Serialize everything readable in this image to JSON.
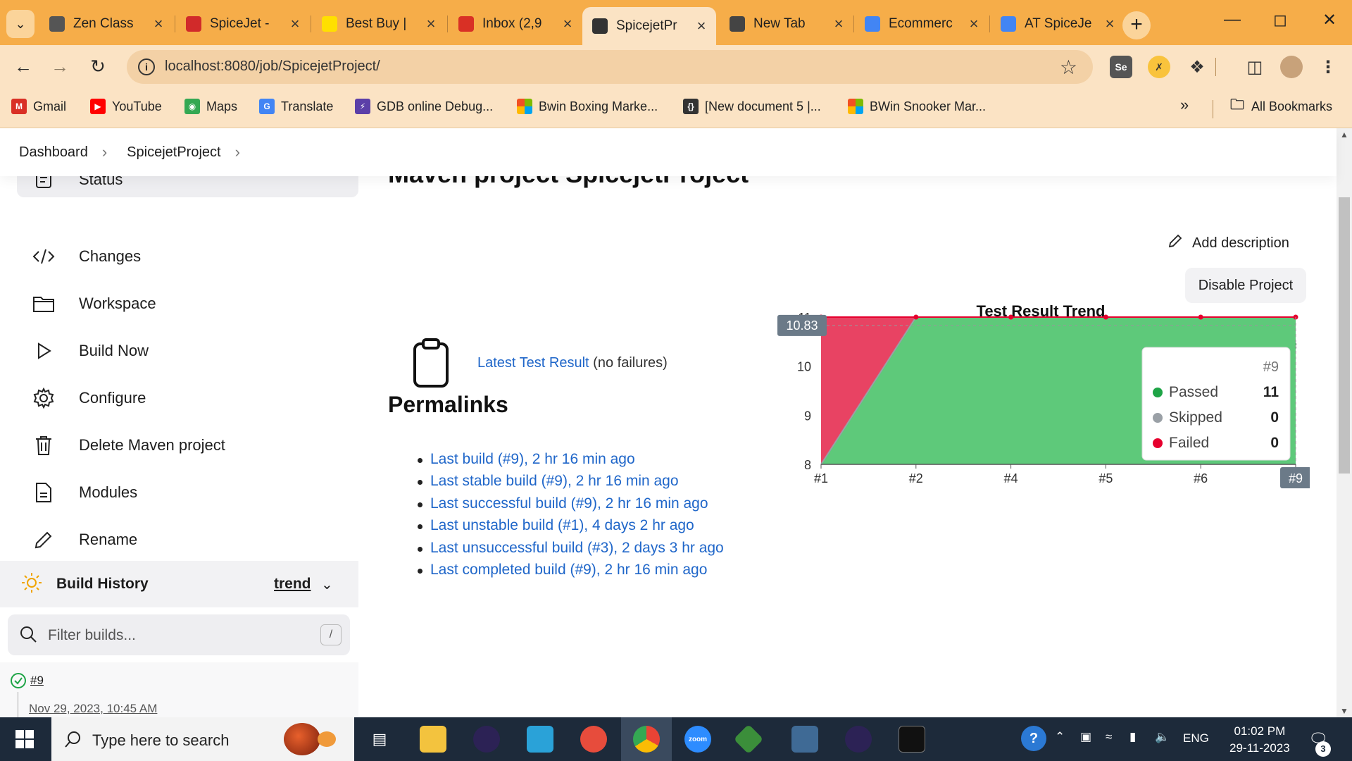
{
  "browser": {
    "tabs": [
      {
        "title": "Zen Class",
        "favicon": "zen-class-icon",
        "color": "#555555"
      },
      {
        "title": "SpiceJet -",
        "favicon": "spicejet-icon",
        "color": "#d12a2a"
      },
      {
        "title": "Best Buy |",
        "favicon": "bestbuy-tag-icon",
        "color": "#ffe000"
      },
      {
        "title": "Inbox (2,9",
        "favicon": "gmail-icon",
        "color": "#d93025"
      },
      {
        "title": "SpicejetPr",
        "favicon": "jenkins-icon",
        "color": "#333333"
      },
      {
        "title": "New Tab",
        "favicon": "chrome-icon",
        "color": "#444444"
      },
      {
        "title": "Ecommerc",
        "favicon": "docs-icon",
        "color": "#4285f4"
      },
      {
        "title": "AT SpiceJe",
        "favicon": "docs-icon",
        "color": "#4285f4"
      }
    ],
    "active_tab_index": 4,
    "url": "localhost:8080/job/SpicejetProject/",
    "bookmarks": [
      {
        "label": "Gmail",
        "icon": "gmail-icon"
      },
      {
        "label": "YouTube",
        "icon": "youtube-icon"
      },
      {
        "label": "Maps",
        "icon": "maps-icon"
      },
      {
        "label": "Translate",
        "icon": "translate-icon"
      },
      {
        "label": "GDB online Debug...",
        "icon": "gdb-icon"
      },
      {
        "label": "Bwin Boxing Marke...",
        "icon": "windows-grid-icon"
      },
      {
        "label": "[New document 5 |...",
        "icon": "braces-icon"
      },
      {
        "label": "BWin Snooker Mar...",
        "icon": "windows-grid-icon"
      }
    ],
    "more_bookmarks": "»",
    "all_bookmarks": "All Bookmarks"
  },
  "jenkins": {
    "breadcrumb": [
      "Dashboard",
      "SpicejetProject"
    ],
    "sidebar": [
      {
        "label": "Status",
        "icon": "status-icon"
      },
      {
        "label": "Changes",
        "icon": "code-icon"
      },
      {
        "label": "Workspace",
        "icon": "folder-icon"
      },
      {
        "label": "Build Now",
        "icon": "play-icon"
      },
      {
        "label": "Configure",
        "icon": "gear-icon"
      },
      {
        "label": "Delete Maven project",
        "icon": "trash-icon"
      },
      {
        "label": "Modules",
        "icon": "document-icon"
      },
      {
        "label": "Rename",
        "icon": "pencil-icon"
      }
    ],
    "build_history": {
      "title": "Build History",
      "trend": "trend",
      "filter_placeholder": "Filter builds...",
      "filter_shortcut": "/",
      "builds": [
        {
          "number": "#9",
          "date": "Nov 29, 2023, 10:45 AM"
        }
      ]
    },
    "title": "Maven project SpicejetProject",
    "add_description": "Add description",
    "disable_project": "Disable Project",
    "latest_test_result": {
      "link": "Latest Test Result",
      "note": "(no failures)"
    },
    "permalinks_title": "Permalinks",
    "permalinks": [
      "Last build (#9), 2 hr 16 min ago",
      "Last stable build (#9), 2 hr 16 min ago",
      "Last successful build (#9), 2 hr 16 min ago",
      "Last unstable build (#1), 4 days 2 hr ago",
      "Last unsuccessful build (#3), 2 days 3 hr ago",
      "Last completed build (#9), 2 hr 16 min ago"
    ]
  },
  "chart_data": {
    "type": "area",
    "title": "Test Result Trend",
    "categories": [
      "#1",
      "#2",
      "#4",
      "#5",
      "#6",
      "#9"
    ],
    "series": [
      {
        "name": "Passed",
        "values": [
          8,
          11,
          11,
          11,
          11,
          11
        ],
        "color": "#1ea446"
      },
      {
        "name": "Skipped",
        "values": [
          0,
          0,
          0,
          0,
          0,
          0
        ],
        "color": "#9aa0a6"
      },
      {
        "name": "Failed",
        "values": [
          3,
          0,
          0,
          0,
          0,
          0
        ],
        "color": "#e6002e"
      }
    ],
    "yticks": [
      8,
      9,
      10,
      11
    ],
    "ylim": [
      8,
      11
    ],
    "y_pointer_label": "10.83",
    "x_pointer_label": "#9",
    "legend": "top",
    "tooltip": {
      "title": "#9",
      "rows": [
        {
          "name": "Passed",
          "value": "11",
          "color": "#1ea446"
        },
        {
          "name": "Skipped",
          "value": "0",
          "color": "#9aa0a6"
        },
        {
          "name": "Failed",
          "value": "0",
          "color": "#e6002e"
        }
      ]
    }
  },
  "taskbar": {
    "search_placeholder": "Type here to search",
    "apps": [
      "task-view-icon",
      "file-explorer-icon",
      "eclipse-icon",
      "app-icon",
      "paint-icon",
      "chrome-icon",
      "zoom-icon",
      "git-icon",
      "mysql-icon",
      "eclipse-icon",
      "terminal-icon"
    ],
    "zoom_label": "zoom",
    "language": "ENG",
    "time": "01:02 PM",
    "date": "29-11-2023",
    "notifications": "3"
  }
}
